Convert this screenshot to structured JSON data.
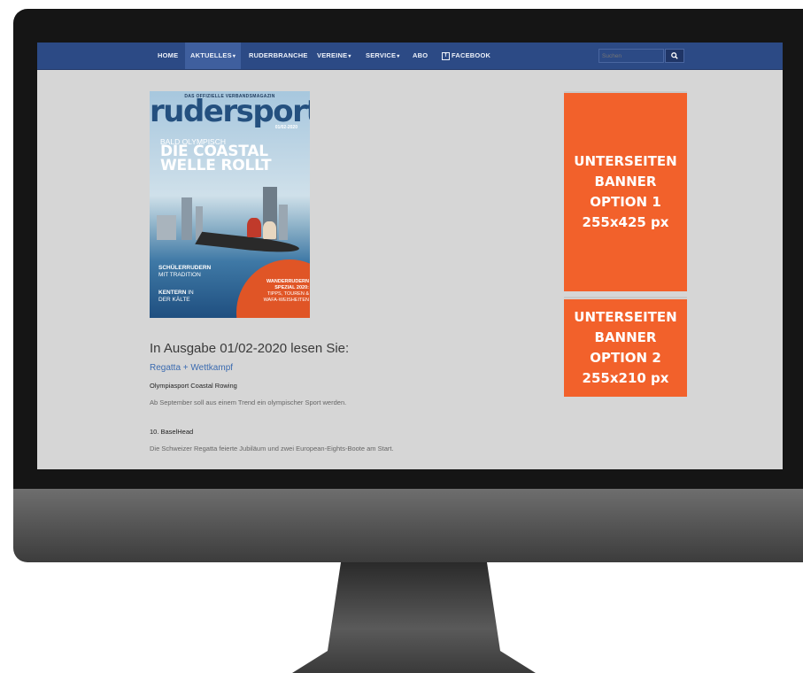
{
  "nav": {
    "items": [
      {
        "label": "HOME",
        "dropdown": false
      },
      {
        "label": "AKTUELLES",
        "dropdown": true,
        "active": true
      },
      {
        "label": "RUDERBRANCHE",
        "dropdown": false
      },
      {
        "label": "VEREINE",
        "dropdown": true
      },
      {
        "label": "SERVICE",
        "dropdown": true
      },
      {
        "label": "ABO",
        "dropdown": false
      },
      {
        "label": "FACEBOOK",
        "dropdown": false,
        "icon": "facebook-icon"
      }
    ],
    "caret": "▾",
    "search_placeholder": "Suchen",
    "search_icon": "search-icon"
  },
  "cover": {
    "tagline": "DAS OFFIZIELLE VERBANDSMAGAZIN",
    "logo": "rudersport",
    "issue": "01/02-2020",
    "kicker": "BALD OLYMPISCH",
    "headline_1": "DIE COASTAL",
    "headline_2": "WELLE ROLLT",
    "side_1_bold": "SCHÜLERRUDERN",
    "side_1_rest": "MIT TRADITION",
    "side_2_bold": "KENTERN",
    "side_2_mid": "IN",
    "side_2_rest": "DER KÄLTE",
    "circle_1": "WANDERRUDERN",
    "circle_2": "SPEZIAL 2020:",
    "circle_3": "TIPPS, TOUREN &",
    "circle_4": "WAFA-WEISHEITEN"
  },
  "article": {
    "heading": "In Ausgabe 01/02-2020 lesen Sie:",
    "section": "Regatta + Wettkampf",
    "items": [
      {
        "title": "Olympiasport Coastal Rowing",
        "desc": "Ab September soll aus einem Trend ein olympischer Sport werden."
      },
      {
        "title": "10. BaselHead",
        "desc": "Die Schweizer Regatta feierte Jubiläum und zwei European-Eights-Boote am Start."
      }
    ]
  },
  "banners": [
    {
      "lines": [
        "UNTERSEITEN",
        "BANNER",
        "OPTION 1",
        "255x425 px"
      ]
    },
    {
      "lines": [
        "UNTERSEITEN",
        "BANNER",
        "OPTION 2",
        "255x210 px"
      ]
    }
  ],
  "colors": {
    "navbar": "#2c4a85",
    "banner": "#f2612b",
    "page_bg": "#d6d6d6",
    "link": "#3b6bb0"
  }
}
